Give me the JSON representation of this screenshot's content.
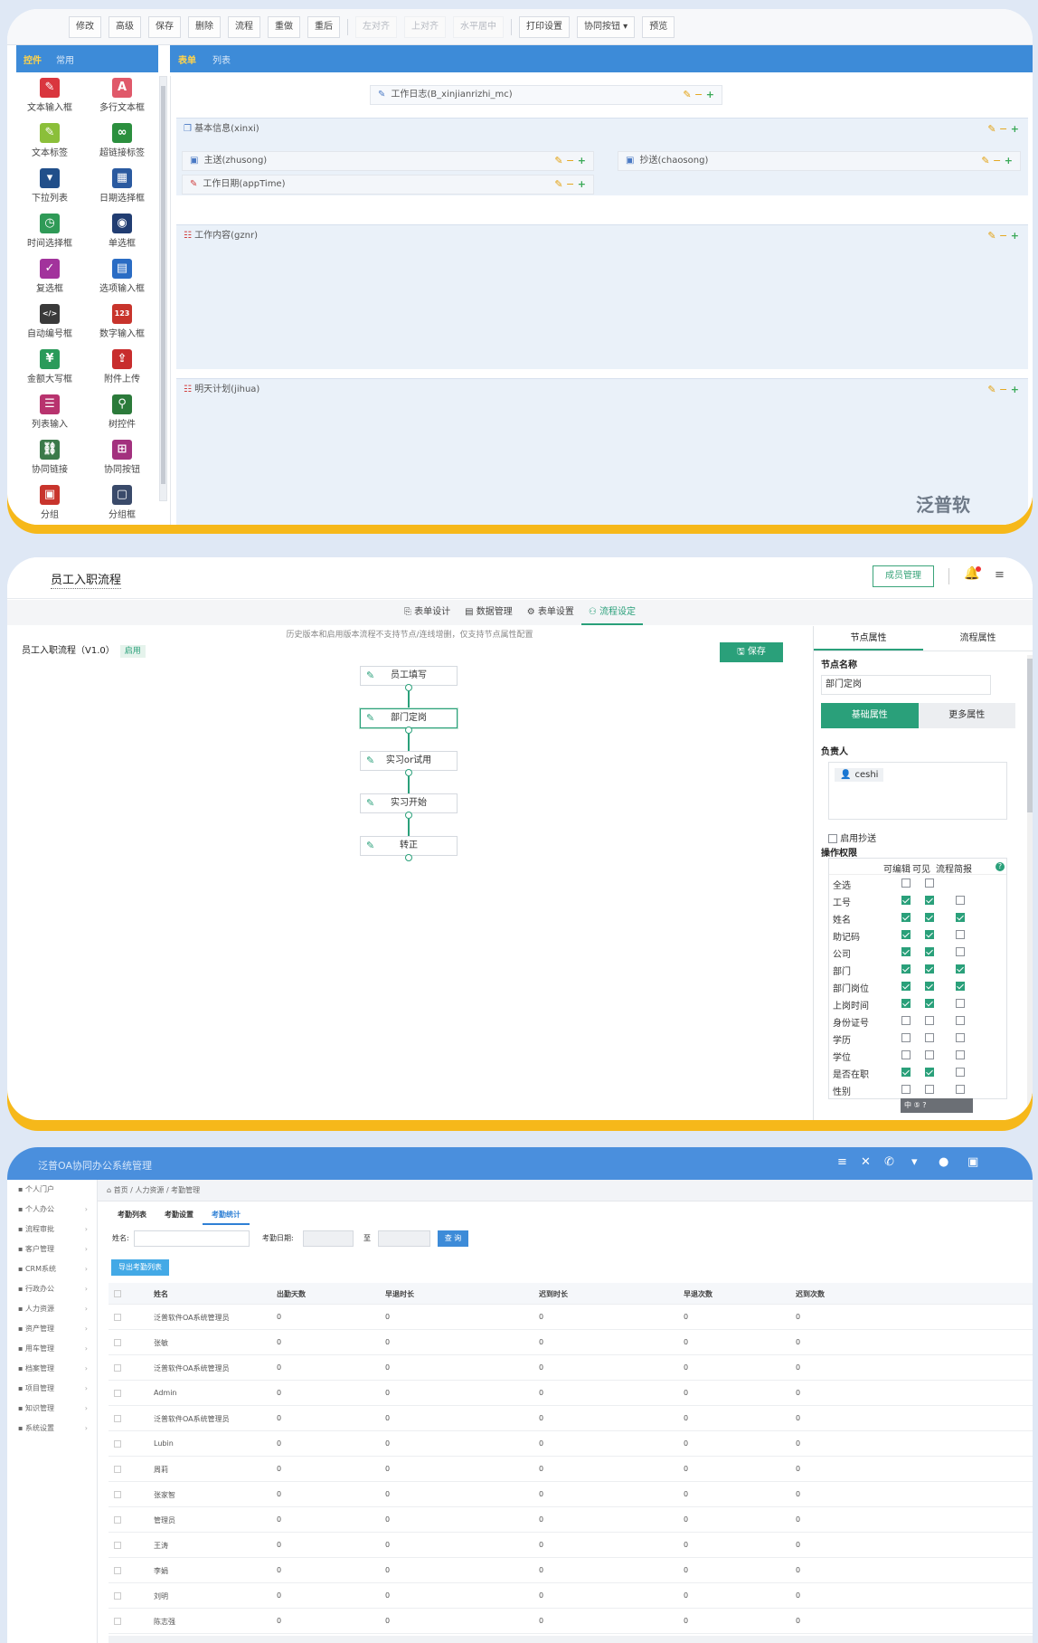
{
  "panel1": {
    "toolbar": [
      {
        "label": "修改",
        "disabled": false
      },
      {
        "label": "高级",
        "disabled": false
      },
      {
        "label": "保存",
        "disabled": false
      },
      {
        "label": "删除",
        "disabled": false
      },
      {
        "label": "流程",
        "disabled": false
      },
      {
        "label": "重做",
        "disabled": false
      },
      {
        "label": "重后",
        "disabled": false
      },
      {
        "label": "左对齐",
        "disabled": true
      },
      {
        "label": "上对齐",
        "disabled": true
      },
      {
        "label": "水平居中",
        "disabled": true
      },
      {
        "label": "打印设置",
        "disabled": false
      },
      {
        "label": "协同按钮 ▾",
        "disabled": false
      },
      {
        "label": "预览",
        "disabled": false
      }
    ],
    "control_tabs": [
      "控件",
      "常用"
    ],
    "controls": [
      {
        "label": "文本输入框",
        "icon": "text-input-icon",
        "glyph": "✎",
        "color": "#d9363e"
      },
      {
        "label": "多行文本框",
        "icon": "textarea-icon",
        "glyph": "A",
        "color": "#e0596a"
      },
      {
        "label": "文本标签",
        "icon": "label-icon",
        "glyph": "✎",
        "color": "#8bbf3a"
      },
      {
        "label": "超链接标签",
        "icon": "link-icon",
        "glyph": "∞",
        "color": "#2b8f3e"
      },
      {
        "label": "下拉列表",
        "icon": "dropdown-icon",
        "glyph": "▾",
        "color": "#214f8a"
      },
      {
        "label": "日期选择框",
        "icon": "calendar-icon",
        "glyph": "▦",
        "color": "#2a5aa0"
      },
      {
        "label": "时间选择框",
        "icon": "clock-icon",
        "glyph": "◷",
        "color": "#2f9a57"
      },
      {
        "label": "单选框",
        "icon": "radio-icon",
        "glyph": "◉",
        "color": "#213d72"
      },
      {
        "label": "复选框",
        "icon": "checkbox-icon",
        "glyph": "✓",
        "color": "#a2339c"
      },
      {
        "label": "选项输入框",
        "icon": "option-input-icon",
        "glyph": "▤",
        "color": "#2a6cc4"
      },
      {
        "label": "自动编号框",
        "icon": "code-icon",
        "glyph": "</>",
        "color": "#3a3a3a"
      },
      {
        "label": "数字输入框",
        "icon": "number-icon",
        "glyph": "123",
        "color": "#c8342c"
      },
      {
        "label": "金额大写框",
        "icon": "money-icon",
        "glyph": "¥",
        "color": "#2a9a5a"
      },
      {
        "label": "附件上传",
        "icon": "upload-icon",
        "glyph": "⇪",
        "color": "#c82d2d"
      },
      {
        "label": "列表输入",
        "icon": "list-icon",
        "glyph": "☰",
        "color": "#b8336e"
      },
      {
        "label": "树控件",
        "icon": "tree-icon",
        "glyph": "⚲",
        "color": "#2b7a3a"
      },
      {
        "label": "协同链接",
        "icon": "collab-link-icon",
        "glyph": "⛓",
        "color": "#3b7a4a"
      },
      {
        "label": "协同按钮",
        "icon": "collab-button-icon",
        "glyph": "⊞",
        "color": "#a3317e"
      },
      {
        "label": "分组",
        "icon": "group-icon",
        "glyph": "▣",
        "color": "#c8342c"
      },
      {
        "label": "分组框",
        "icon": "groupbox-icon",
        "glyph": "▢",
        "color": "#3a4a6a"
      }
    ],
    "form_tabs": [
      "表单",
      "列表"
    ],
    "title_field": "工作日志(B_xinjianrizhi_mc)",
    "group1": "基本信息(xinxi)",
    "field_zhusong": "主送(zhusong)",
    "field_chaosong": "抄送(chaosong)",
    "field_date": "工作日期(appTime)",
    "group2": "工作内容(gznr)",
    "group3": "明天计划(jihua)",
    "tools": "✎ − +",
    "watermark": "泛普软"
  },
  "panel2": {
    "title": "员工入职流程",
    "member_btn": "成员管理",
    "tabs": [
      {
        "label": "⎘ 表单设计",
        "active": false
      },
      {
        "label": "▤ 数据管理",
        "active": false
      },
      {
        "label": "⚙ 表单设置",
        "active": false
      },
      {
        "label": "⚇ 流程设定",
        "active": true
      }
    ],
    "notice": "历史版本和启用版本流程不支持节点/连线增删，仅支持节点属性配置",
    "workflow_name": "员工入职流程（V1.0）",
    "status_badge": "启用",
    "save_btn": "🖫 保存",
    "nodes": [
      "员工填写",
      "部门定岗",
      "实习or试用",
      "实习开始",
      "转正"
    ],
    "selected_node_index": 1,
    "right_tabs": [
      "节点属性",
      "流程属性"
    ],
    "node_name_label": "节点名称",
    "node_name_value": "部门定岗",
    "basic_attr": "基础属性",
    "more_attr": "更多属性",
    "owner_label": "负责人",
    "owner": "ceshi",
    "enable_cc": "启用抄送",
    "perm_label": "操作权限",
    "perm_headers": [
      "可编辑",
      "可见",
      "流程简报"
    ],
    "permissions": [
      {
        "name": "全选",
        "edit": false,
        "view": false,
        "brief": null
      },
      {
        "name": "工号",
        "edit": true,
        "view": true,
        "brief": false
      },
      {
        "name": "姓名",
        "edit": true,
        "view": true,
        "brief": true
      },
      {
        "name": "助记码",
        "edit": true,
        "view": true,
        "brief": false
      },
      {
        "name": "公司",
        "edit": true,
        "view": true,
        "brief": false
      },
      {
        "name": "部门",
        "edit": true,
        "view": true,
        "brief": true
      },
      {
        "name": "部门岗位",
        "edit": true,
        "view": true,
        "brief": true
      },
      {
        "name": "上岗时间",
        "edit": true,
        "view": true,
        "brief": false
      },
      {
        "name": "身份证号",
        "edit": false,
        "view": false,
        "brief": false
      },
      {
        "name": "学历",
        "edit": false,
        "view": false,
        "brief": false
      },
      {
        "name": "学位",
        "edit": false,
        "view": false,
        "brief": false
      },
      {
        "name": "是否在职",
        "edit": true,
        "view": true,
        "brief": false
      },
      {
        "name": "性别",
        "edit": false,
        "view": false,
        "brief": false
      }
    ],
    "ime": "中 ⑤ ?"
  },
  "panel3": {
    "title": "泛普OA协同办公系统管理",
    "sidebar": [
      "个人门户",
      "个人办公",
      "流程审批",
      "客户管理",
      "CRM系统",
      "行政办公",
      "人力资源",
      "资产管理",
      "用车管理",
      "档案管理",
      "项目管理",
      "知识管理",
      "系统设置"
    ],
    "breadcrumb": "首页 / 人力资源 / 考勤管理",
    "tabs": [
      "考勤列表",
      "考勤设置",
      "考勤统计"
    ],
    "filter_name": "姓名:",
    "filter_date": "考勤日期:",
    "filter_to": "至",
    "query_btn": "查 询",
    "export_btn": "导出考勤列表",
    "headers": [
      "姓名",
      "出勤天数",
      "早退时长",
      "迟到时长",
      "早退次数",
      "迟到次数"
    ],
    "rows": [
      [
        "泛普软件OA系统管理员",
        "0",
        "0",
        "0",
        "0",
        "0"
      ],
      [
        "张敏",
        "0",
        "0",
        "0",
        "0",
        "0"
      ],
      [
        "泛普软件OA系统管理员",
        "0",
        "0",
        "0",
        "0",
        "0"
      ],
      [
        "Admin",
        "0",
        "0",
        "0",
        "0",
        "0"
      ],
      [
        "泛普软件OA系统管理员",
        "0",
        "0",
        "0",
        "0",
        "0"
      ],
      [
        "Lubin",
        "0",
        "0",
        "0",
        "0",
        "0"
      ],
      [
        "周莉",
        "0",
        "0",
        "0",
        "0",
        "0"
      ],
      [
        "张家智",
        "0",
        "0",
        "0",
        "0",
        "0"
      ],
      [
        "管理员",
        "0",
        "0",
        "0",
        "0",
        "0"
      ],
      [
        "王涛",
        "0",
        "0",
        "0",
        "0",
        "0"
      ],
      [
        "李娟",
        "0",
        "0",
        "0",
        "0",
        "0"
      ],
      [
        "刘明",
        "0",
        "0",
        "0",
        "0",
        "0"
      ],
      [
        "陈志强",
        "0",
        "0",
        "0",
        "0",
        "0"
      ]
    ]
  }
}
